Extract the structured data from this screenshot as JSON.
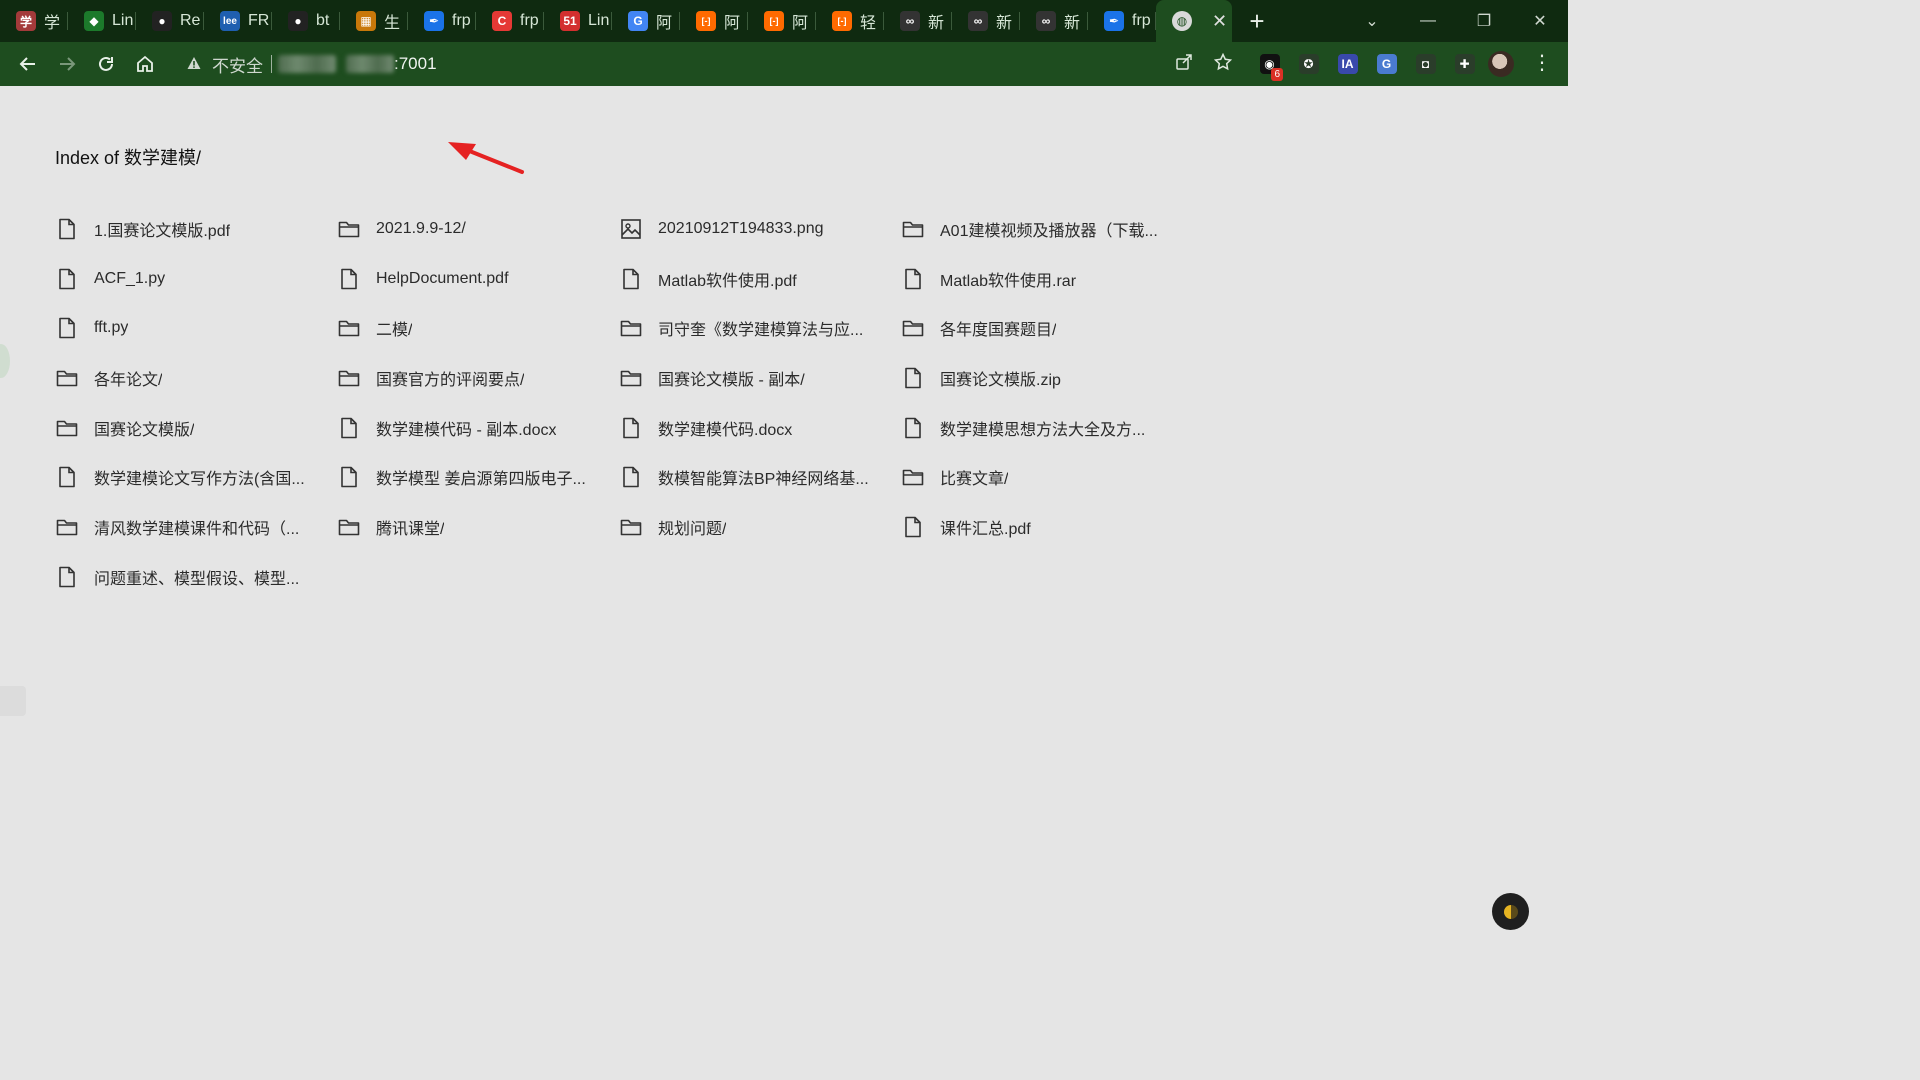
{
  "tabs": [
    {
      "label": "学",
      "favicon": "avatar-icon",
      "color": "#a33a3a"
    },
    {
      "label": "Lin",
      "favicon": "shield-green-icon",
      "color": "#1c7a2b"
    },
    {
      "label": "Re",
      "favicon": "github-icon",
      "color": "#222222"
    },
    {
      "label": "FR",
      "favicon": "lee-icon",
      "color": "#1f5fb0"
    },
    {
      "label": "bt",
      "favicon": "github-icon",
      "color": "#222222"
    },
    {
      "label": "生",
      "favicon": "grid-orange-icon",
      "color": "#c8780a"
    },
    {
      "label": "frp",
      "favicon": "feather-icon",
      "color": "#1a73e8"
    },
    {
      "label": "frp",
      "favicon": "c-red-icon",
      "color": "#e53935"
    },
    {
      "label": "Lin",
      "favicon": "51-icon",
      "color": "#d32f2f"
    },
    {
      "label": "阿",
      "favicon": "google-icon",
      "color": "#4285f4"
    },
    {
      "label": "阿",
      "favicon": "aliyun-icon",
      "color": "#ff6a00"
    },
    {
      "label": "阿",
      "favicon": "aliyun-icon",
      "color": "#ff6a00"
    },
    {
      "label": "轻",
      "favicon": "aliyun-icon",
      "color": "#ff6a00"
    },
    {
      "label": "新",
      "favicon": "infinity-icon",
      "color": "#333333"
    },
    {
      "label": "新",
      "favicon": "infinity-icon",
      "color": "#333333"
    },
    {
      "label": "新",
      "favicon": "infinity-icon",
      "color": "#333333"
    },
    {
      "label": "frp",
      "favicon": "feather-icon",
      "color": "#1a73e8"
    }
  ],
  "active_tab": {
    "favicon": "globe-icon",
    "close": "✕"
  },
  "new_tab_label": "+",
  "window_controls": {
    "tab_search": "⌄",
    "minimize": "—",
    "restore": "❐",
    "close": "✕"
  },
  "address_bar": {
    "security_label": "不安全",
    "url_suffix": ":7001"
  },
  "extensions": [
    {
      "name": "ext-1",
      "icon": "record-icon",
      "badge": "6",
      "color": "#111111"
    },
    {
      "name": "ext-2",
      "icon": "tampermonkey-icon",
      "badge": "",
      "color": "#2a3d2a"
    },
    {
      "name": "ext-3",
      "icon": "ia-icon",
      "badge": "",
      "color": "#3949ab"
    },
    {
      "name": "ext-4",
      "icon": "translate-icon",
      "badge": "",
      "color": "#4a7bd0"
    },
    {
      "name": "ext-5",
      "icon": "camera-icon",
      "badge": "",
      "color": "#2a3d2a"
    },
    {
      "name": "ext-6",
      "icon": "puzzle-icon",
      "badge": "",
      "color": "#2a3d2a"
    }
  ],
  "page": {
    "title": "Index of  数学建模/",
    "entries": [
      {
        "name": "1.国赛论文模版.pdf",
        "type": "file"
      },
      {
        "name": "2021.9.9-12/",
        "type": "folder"
      },
      {
        "name": "20210912T194833.png",
        "type": "image"
      },
      {
        "name": "A01建模视频及播放器（下载...",
        "type": "folder"
      },
      {
        "name": "ACF_1.py",
        "type": "file"
      },
      {
        "name": "HelpDocument.pdf",
        "type": "file"
      },
      {
        "name": "Matlab软件使用.pdf",
        "type": "file"
      },
      {
        "name": "Matlab软件使用.rar",
        "type": "file"
      },
      {
        "name": "fft.py",
        "type": "file"
      },
      {
        "name": "二模/",
        "type": "folder"
      },
      {
        "name": "司守奎《数学建模算法与应...",
        "type": "folder"
      },
      {
        "name": "各年度国赛题目/",
        "type": "folder"
      },
      {
        "name": "各年论文/",
        "type": "folder"
      },
      {
        "name": "国赛官方的评阅要点/",
        "type": "folder"
      },
      {
        "name": "国赛论文模版 - 副本/",
        "type": "folder"
      },
      {
        "name": "国赛论文模版.zip",
        "type": "file"
      },
      {
        "name": "国赛论文模版/",
        "type": "folder"
      },
      {
        "name": "数学建模代码 - 副本.docx",
        "type": "file"
      },
      {
        "name": "数学建模代码.docx",
        "type": "file"
      },
      {
        "name": "数学建模思想方法大全及方...",
        "type": "file"
      },
      {
        "name": "数学建模论文写作方法(含国...",
        "type": "file"
      },
      {
        "name": "数学模型 姜启源第四版电子...",
        "type": "file"
      },
      {
        "name": "数模智能算法BP神经网络基...",
        "type": "file"
      },
      {
        "name": "比赛文章/",
        "type": "folder"
      },
      {
        "name": "清风数学建模课件和代码（...",
        "type": "folder"
      },
      {
        "name": "腾讯课堂/",
        "type": "folder"
      },
      {
        "name": "规划问题/",
        "type": "folder"
      },
      {
        "name": "课件汇总.pdf",
        "type": "file"
      },
      {
        "name": "问题重述、模型假设、模型...",
        "type": "file"
      }
    ]
  },
  "colors": {
    "tabstrip": "#0f2a10",
    "toolbar": "#1e4d1f",
    "page_bg": "#e5e5e5",
    "arrow": "#e52222"
  }
}
